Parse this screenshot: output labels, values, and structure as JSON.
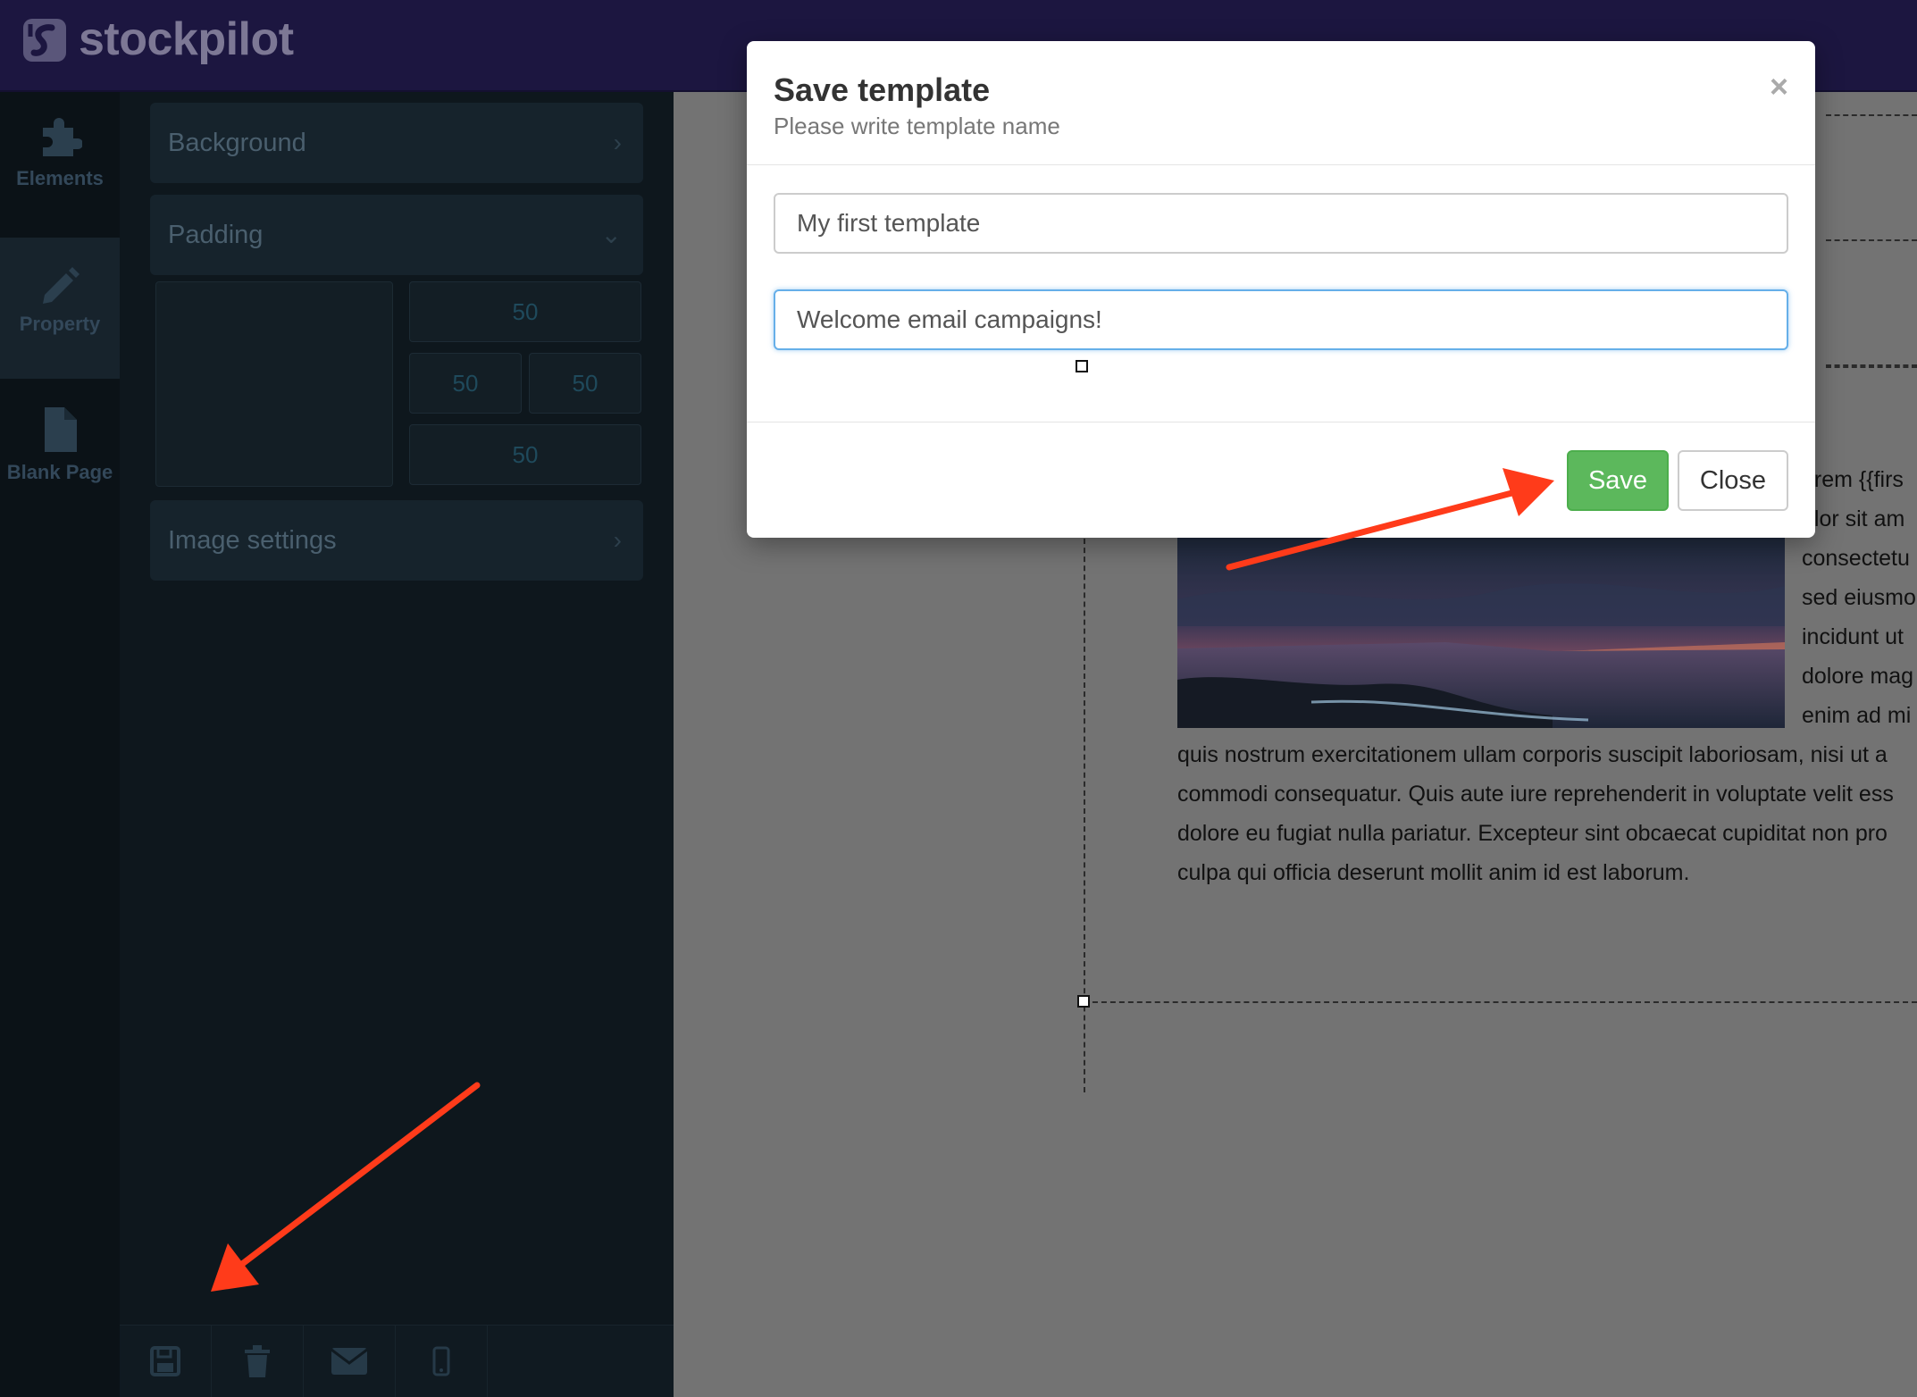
{
  "brand": {
    "name": "stockpilot"
  },
  "rail": {
    "items": [
      {
        "label": "Elements",
        "icon": "puzzle-icon"
      },
      {
        "label": "Property",
        "icon": "pencil-icon"
      },
      {
        "label": "Blank Page",
        "icon": "file-icon"
      }
    ]
  },
  "panel": {
    "sections": {
      "background": "Background",
      "padding": "Padding",
      "image_settings": "Image settings"
    },
    "padding_values": {
      "top": "50",
      "left": "50",
      "right": "50",
      "bottom": "50"
    },
    "toolbar": [
      {
        "icon": "save-icon"
      },
      {
        "icon": "trash-icon"
      },
      {
        "icon": "envelope-icon"
      },
      {
        "icon": "mobile-icon"
      }
    ]
  },
  "canvas": {
    "side_text": [
      "orem {{firs",
      "olor sit am",
      "consectetu",
      "sed eiusmo",
      "incidunt ut",
      "dolore mag",
      "enim ad mi"
    ],
    "paragraph": [
      "quis nostrum exercitationem ullam corporis suscipit laboriosam, nisi ut a",
      "commodi consequatur. Quis aute iure reprehenderit in voluptate velit ess",
      "dolore eu fugiat nulla pariatur. Excepteur sint obcaecat cupiditat non pro",
      "culpa qui officia deserunt mollit anim id est laborum."
    ]
  },
  "modal": {
    "title": "Save template",
    "subtitle": "Please write template name",
    "close_icon": "×",
    "template_name": "My first template",
    "template_description": "Welcome email campaigns!",
    "save_label": "Save",
    "close_label": "Close"
  },
  "colors": {
    "header": "#1c1640",
    "save_button": "#5cb85c",
    "annotation_arrow": "#ff3b1a"
  }
}
